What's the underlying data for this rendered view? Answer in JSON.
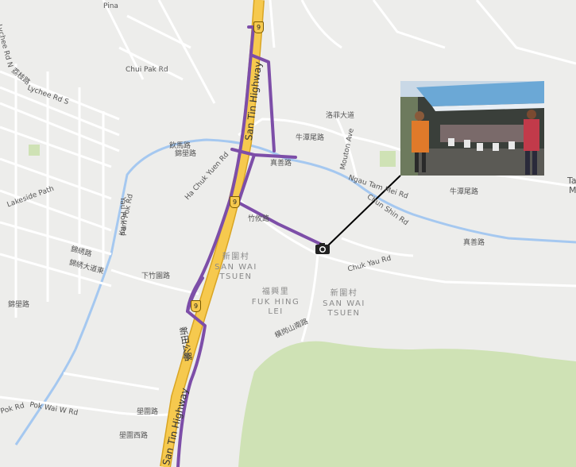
{
  "map": {
    "shields": [
      "9",
      "9",
      "9"
    ],
    "highway": {
      "name_north": "San Tin Highway",
      "name_south": "San Tin Highway",
      "name_zh": "新田公路"
    },
    "places": {
      "san_wai_zh": "新圍村",
      "san_wai_en": "SAN WAI TSUEN",
      "fuk_hing_zh": "福興里",
      "fuk_hing_en": "FUK HING LEI",
      "san_wai2_zh": "新圍村",
      "san_wai2_en": "SAN WAI TSUEN"
    },
    "roads": {
      "lychee_n": "Lychee Rd N",
      "lychee_s": "Lychee Rd S",
      "lychee_zh": "荔枝路",
      "lakeside": "Lakeside Path",
      "yau_pok": "Yau Pok Rd",
      "kam_pok": "Kam Pok Rd",
      "ha_chuk_yuen": "Ha Chuk Yuen Rd",
      "chui_pak": "Chui Pak Rd",
      "pok_rd": "Pok Rd",
      "pok_wai_w": "Pok Wai W Rd",
      "mouton": "Mouton Ave",
      "ngau_tam_mei": "Ngau Tam Mei Rd",
      "chun_shin": "Chun Shin Rd",
      "chuk_yau": "Chuk Yau Rd",
      "ngau_tam_mei_zh": "牛潭尾路",
      "ngau_tam_mei_zh2": "牛潭尾路",
      "chun_shin_zh": "真善路",
      "chun_shin_zh2": "真善路",
      "yin_fai": "洛菲大道",
      "yin_on": "飲馬路",
      "kam_pok_zh": "錦壆路",
      "ha_chuk_yuen_zh": "下竹園路",
      "kam_pok_dai": "錦綉大道東",
      "kam_pok_2": "錦綉路",
      "pok_wai_w_zh": "壆圍西路",
      "pok_wai": "壆圍路",
      "chuk_yau_zh": "竹攸路",
      "kwong_kok": "橫岗山南路",
      "kam_pok_w": "錦壆路",
      "san_tin_road_zh": "路"
    },
    "edge_labels": {
      "ta": "Ta",
      "m": "M",
      "pina": "Pina"
    },
    "colors": {
      "background": "#ededeb",
      "park": "#cfe2b5",
      "river": "#a5c8f0",
      "highway": "#f6c94e",
      "route": "#7d4ea8",
      "road": "#ffffff"
    },
    "photo": {
      "subject": "outdoor market stall with people under canopy"
    }
  }
}
